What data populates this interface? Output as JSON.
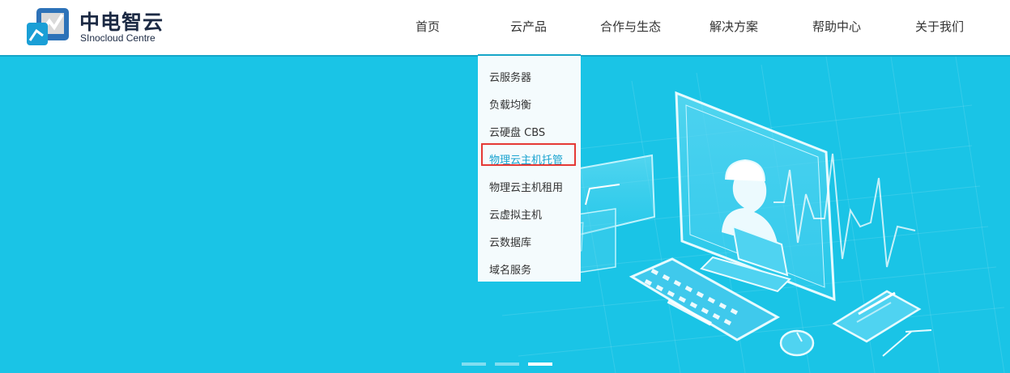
{
  "brand": {
    "name": "中电智云",
    "subtitle": "SInocloud Centre"
  },
  "nav": [
    {
      "label": "首页"
    },
    {
      "label": "云产品"
    },
    {
      "label": "合作与生态"
    },
    {
      "label": "解决方案"
    },
    {
      "label": "帮助中心"
    },
    {
      "label": "关于我们"
    }
  ],
  "dropdown": {
    "items": [
      {
        "label": "云服务器"
      },
      {
        "label": "负载均衡"
      },
      {
        "label": "云硬盘 CBS"
      },
      {
        "label": "物理云主机托管"
      },
      {
        "label": "物理云主机租用"
      },
      {
        "label": "云虚拟主机"
      },
      {
        "label": "云数据库"
      },
      {
        "label": "域名服务"
      }
    ],
    "highlighted": "物理云主机托管"
  },
  "carousel": {
    "slides": 3,
    "active_index": 2
  },
  "colors": {
    "banner_bg": "#1ac4e6",
    "accent": "#16a6c8",
    "highlight_box": "#e53935",
    "highlight_text": "#1aa3d0"
  }
}
